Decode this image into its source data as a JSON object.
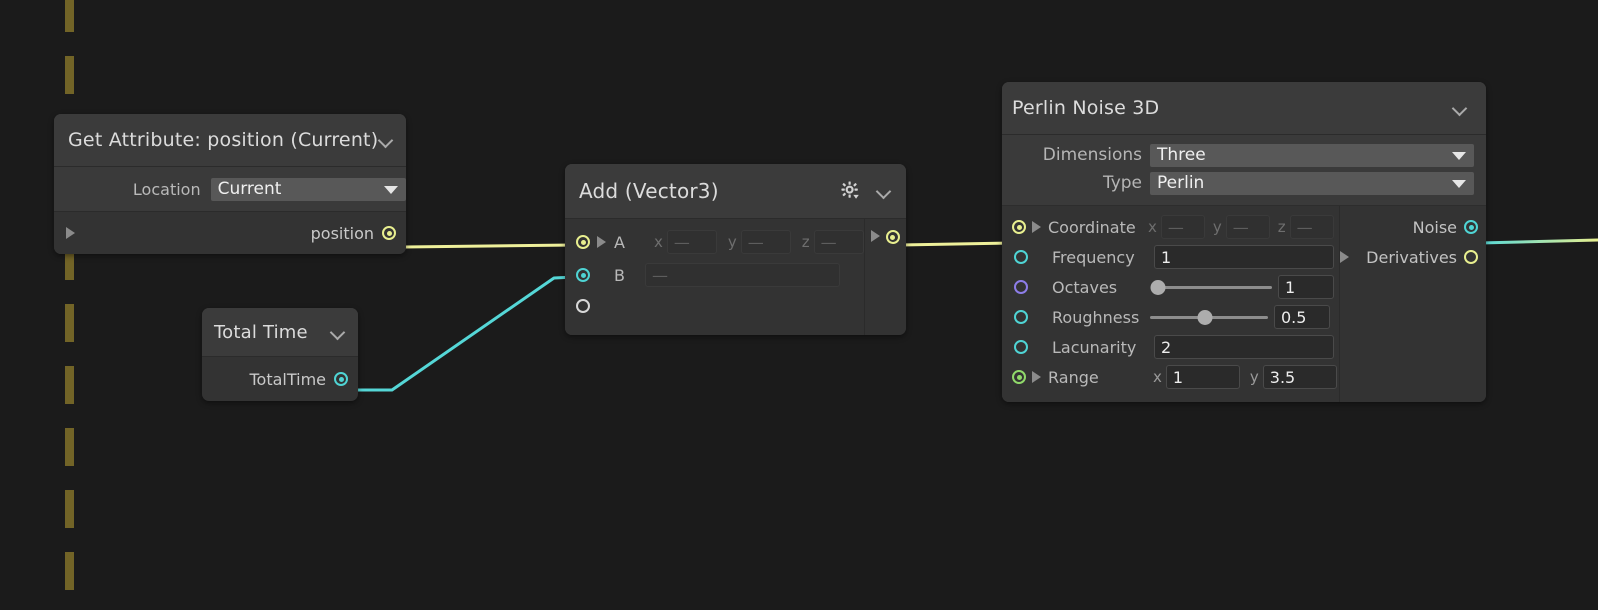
{
  "canvas": {
    "background": "#1b1b1b",
    "guide_color": "#7a6a28"
  },
  "colors": {
    "wire_vector": "#eef09a",
    "wire_float": "#55d7d7",
    "port_vector": "#e8ef8f",
    "port_float": "#4fd4d4",
    "port_int": "#8d7de8",
    "port_range": "#90d96a",
    "port_exec": "#d8d8d8"
  },
  "nodes": {
    "get_attribute": {
      "title": "Get Attribute: position (Current)",
      "collapse_icon": "chevron-down-icon",
      "param": {
        "label": "Location",
        "value": "Current",
        "caret_icon": "caret-down-icon"
      },
      "output": {
        "label": "position",
        "expander_icon": "triangle-right-icon",
        "port": "vector"
      }
    },
    "total_time": {
      "title": "Total Time",
      "collapse_icon": "chevron-down-icon",
      "output": {
        "label": "TotalTime",
        "port": "float"
      }
    },
    "add_vector3": {
      "title": "Add (Vector3)",
      "gear_icon": "gear-dropdown-icon",
      "collapse_icon": "chevron-down-icon",
      "inputs": [
        {
          "label": "A",
          "port": "vector",
          "expander_icon": "triangle-right-icon",
          "fields": [
            {
              "axis": "x",
              "value": "—"
            },
            {
              "axis": "y",
              "value": "—"
            },
            {
              "axis": "z",
              "value": "—"
            }
          ]
        },
        {
          "label": "B",
          "port": "float",
          "value": "—"
        },
        {
          "label": "",
          "port": "exec"
        }
      ],
      "output": {
        "expander_icon": "triangle-right-icon",
        "port": "vector"
      }
    },
    "perlin_noise_3d": {
      "title": "Perlin Noise 3D",
      "collapse_icon": "chevron-down-icon",
      "params": [
        {
          "label": "Dimensions",
          "value": "Three",
          "caret_icon": "caret-down-icon"
        },
        {
          "label": "Type",
          "value": "Perlin",
          "caret_icon": "caret-down-icon"
        }
      ],
      "inputs": [
        {
          "label": "Coordinate",
          "port": "vector",
          "expander_icon": "triangle-right-icon",
          "kind": "vector3-disabled",
          "fields": [
            {
              "axis": "x",
              "value": "—"
            },
            {
              "axis": "y",
              "value": "—"
            },
            {
              "axis": "z",
              "value": "—"
            }
          ]
        },
        {
          "label": "Frequency",
          "port": "float",
          "kind": "text",
          "value": "1"
        },
        {
          "label": "Octaves",
          "port": "int",
          "kind": "slider",
          "value": "1",
          "slider_pct": 3
        },
        {
          "label": "Roughness",
          "port": "float",
          "kind": "slider",
          "value": "0.5",
          "slider_pct": 47
        },
        {
          "label": "Lacunarity",
          "port": "float",
          "kind": "text",
          "value": "2"
        },
        {
          "label": "Range",
          "port": "range",
          "expander_icon": "triangle-right-icon",
          "kind": "vector2",
          "fields": [
            {
              "axis": "x",
              "value": "1"
            },
            {
              "axis": "y",
              "value": "3.5"
            }
          ]
        }
      ],
      "outputs": [
        {
          "label": "Noise",
          "port": "float",
          "filled": true
        },
        {
          "label": "Derivatives",
          "port": "vector",
          "filled": false,
          "expander_icon": "triangle-right-icon"
        }
      ]
    }
  },
  "wires": [
    {
      "from": "get_attribute.position",
      "to": "add_vector3.A",
      "type": "vector"
    },
    {
      "from": "total_time.TotalTime",
      "to": "add_vector3.B",
      "type": "float"
    },
    {
      "from": "add_vector3.output",
      "to": "perlin_noise_3d.Coordinate",
      "type": "vector"
    },
    {
      "from": "perlin_noise_3d.Noise",
      "to": "offscreen-right",
      "type": "float"
    }
  ]
}
